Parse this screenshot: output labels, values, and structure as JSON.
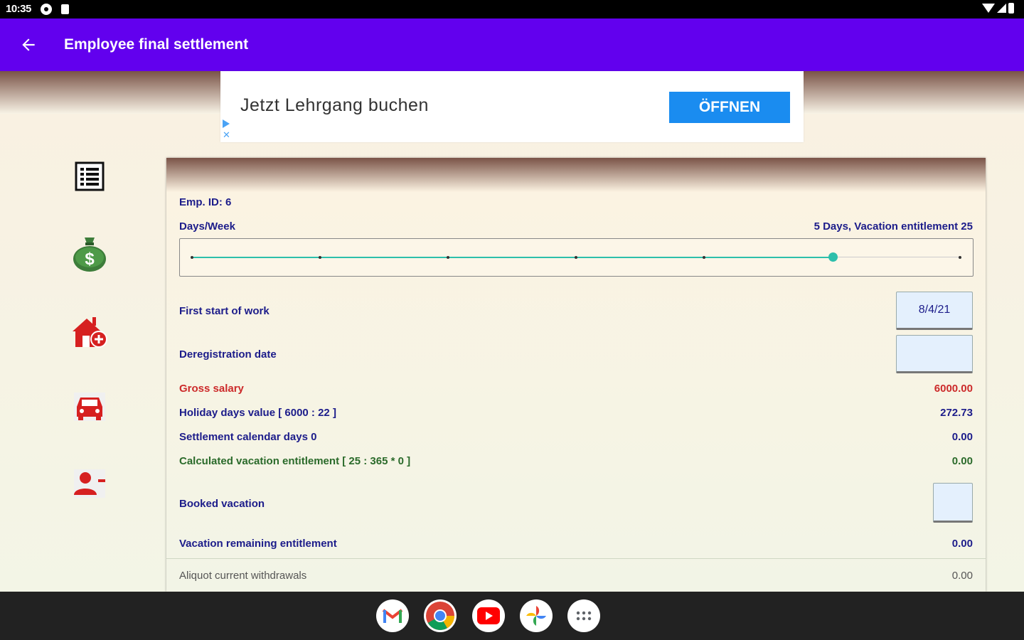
{
  "status_bar": {
    "time": "10:35"
  },
  "app_bar": {
    "title": "Employee final settlement"
  },
  "ad": {
    "text": "Jetzt Lehrgang buchen",
    "button": "ÖFFNEN"
  },
  "sidebar": {
    "items": [
      {
        "icon": "list-icon"
      },
      {
        "icon": "money-bag-icon"
      },
      {
        "icon": "house-add-icon"
      },
      {
        "icon": "car-icon"
      },
      {
        "icon": "person-remove-icon"
      }
    ]
  },
  "form": {
    "emp_id": "Emp. ID: 6",
    "days_week_label": "Days/Week",
    "days_week_value": "5 Days, Vacation entitlement  25",
    "days_week_slider": {
      "min": 1,
      "max": 7,
      "value": 5
    },
    "first_start_label": "First start of work",
    "first_start_value": "8/4/21",
    "deregistration_label": "Deregistration date",
    "deregistration_value": "",
    "gross_salary_label": "Gross salary",
    "gross_salary_value": "6000.00",
    "holiday_days_label": "Holiday days value [ 6000 : 22 ]",
    "holiday_days_value": "272.73",
    "settlement_days_label": "Settlement calendar days 0",
    "settlement_days_value": "0.00",
    "calc_vacation_label": "Calculated vacation entitlement [ 25 : 365 * 0 ]",
    "calc_vacation_value": "0.00",
    "booked_vacation_label": "Booked vacation",
    "booked_vacation_value": "",
    "vacation_remaining_label": "Vacation remaining entitlement",
    "vacation_remaining_value": "0.00",
    "aliquot_label": "Aliquot current withdrawals",
    "aliquot_value": "0.00"
  },
  "dock": {
    "apps": [
      "gmail-icon",
      "chrome-icon",
      "youtube-icon",
      "photos-icon",
      "app-drawer-icon"
    ]
  },
  "colors": {
    "app_bar": "#6200ee",
    "accent_teal": "#2dbfab",
    "label_blue": "#1c1c8a",
    "salary_red": "#cc2a2a",
    "ad_button": "#1a8cf0"
  }
}
